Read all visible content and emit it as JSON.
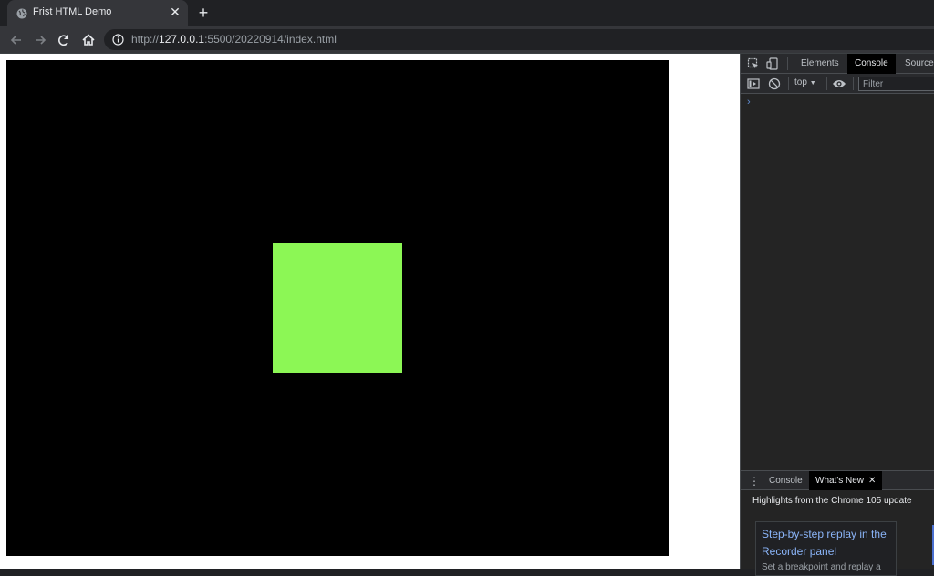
{
  "browser": {
    "tab": {
      "title": "Frist HTML Demo",
      "close": "✕",
      "favicon": "globe-icon"
    },
    "new_tab": "+",
    "nav": {
      "back": "arrow-left-icon",
      "forward": "arrow-right-icon",
      "reload": "reload-icon",
      "home": "home-icon"
    },
    "address": {
      "scheme": "http://",
      "host": "127.0.0.1",
      "rest": ":5500/20220914/index.html",
      "info": "info-icon"
    }
  },
  "page": {
    "canvas_color": "#000000",
    "square_color": "#8cf755"
  },
  "devtools": {
    "tabs": [
      {
        "label": "Elements"
      },
      {
        "label": "Console",
        "active": true
      },
      {
        "label": "Sources"
      }
    ],
    "console": {
      "context": "top",
      "filter_placeholder": "Filter",
      "prompt": "›"
    },
    "drawer": {
      "tabs": [
        {
          "label": "Console"
        },
        {
          "label": "What's New",
          "active": true,
          "close": "✕"
        }
      ],
      "menu": "⋮"
    },
    "whats_new": {
      "heading": "Highlights from the Chrome 105 update",
      "card_title": "Step-by-step replay in the Recorder panel",
      "card_desc": "Set a breakpoint and replay a"
    }
  }
}
